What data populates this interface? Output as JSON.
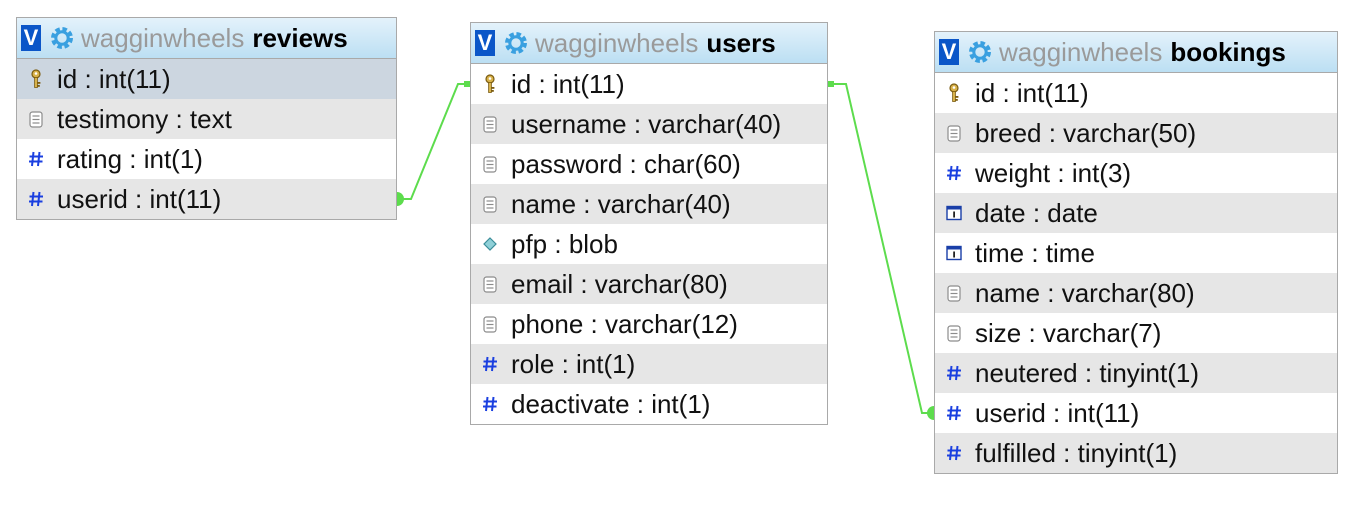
{
  "colors": {
    "header_bg": "#bcdff3",
    "v_box": "#0b56c8",
    "gear": "#3aa0e0",
    "link": "#5ddc4d",
    "alt_row": "#e6e6e6",
    "selected_row": "#ccd6e0"
  },
  "tables": [
    {
      "key": "reviews",
      "db": "wagginwheels",
      "name": "reviews",
      "columns": [
        {
          "label": "id : int(11)",
          "icon": "key-icon"
        },
        {
          "label": "testimony : text",
          "icon": "text-icon"
        },
        {
          "label": "rating : int(1)",
          "icon": "hash-icon"
        },
        {
          "label": "userid : int(11)",
          "icon": "hash-icon"
        }
      ]
    },
    {
      "key": "users",
      "db": "wagginwheels",
      "name": "users",
      "columns": [
        {
          "label": "id : int(11)",
          "icon": "key-icon"
        },
        {
          "label": "username : varchar(40)",
          "icon": "text-icon"
        },
        {
          "label": "password : char(60)",
          "icon": "text-icon"
        },
        {
          "label": "name : varchar(40)",
          "icon": "text-icon"
        },
        {
          "label": "pfp : blob",
          "icon": "blob-icon"
        },
        {
          "label": "email : varchar(80)",
          "icon": "text-icon"
        },
        {
          "label": "phone : varchar(12)",
          "icon": "text-icon"
        },
        {
          "label": "role : int(1)",
          "icon": "hash-icon"
        },
        {
          "label": "deactivate : int(1)",
          "icon": "hash-icon"
        }
      ]
    },
    {
      "key": "bookings",
      "db": "wagginwheels",
      "name": "bookings",
      "columns": [
        {
          "label": "id : int(11)",
          "icon": "key-icon"
        },
        {
          "label": "breed : varchar(50)",
          "icon": "text-icon"
        },
        {
          "label": "weight : int(3)",
          "icon": "hash-icon"
        },
        {
          "label": "date : date",
          "icon": "date-icon"
        },
        {
          "label": "time : time",
          "icon": "date-icon"
        },
        {
          "label": "name : varchar(80)",
          "icon": "text-icon"
        },
        {
          "label": "size : varchar(7)",
          "icon": "text-icon"
        },
        {
          "label": "neutered : tinyint(1)",
          "icon": "hash-icon"
        },
        {
          "label": "userid : int(11)",
          "icon": "hash-icon"
        },
        {
          "label": "fulfilled : tinyint(1)",
          "icon": "hash-icon"
        }
      ]
    }
  ],
  "relations": [
    {
      "from_table": "reviews",
      "from_column": "userid",
      "to_table": "users",
      "to_column": "id"
    },
    {
      "from_table": "bookings",
      "from_column": "userid",
      "to_table": "users",
      "to_column": "id"
    }
  ]
}
